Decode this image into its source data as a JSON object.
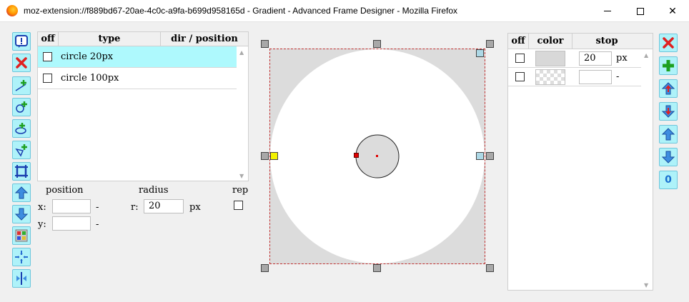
{
  "window": {
    "title": "moz-extension://f889bd67-20ae-4c0c-a9fa-b699d958165d - Gradient - Advanced Frame Designer - Mozilla Firefox",
    "minimize": "",
    "maximize": "",
    "close": "✕"
  },
  "left_toolbar": [
    {
      "name": "info-button",
      "icon": "info-icon"
    },
    {
      "name": "delete-layer-button",
      "icon": "red-x-icon"
    },
    {
      "name": "add-linear-button",
      "icon": "add-linear-icon"
    },
    {
      "name": "add-radial-button",
      "icon": "add-radial-icon"
    },
    {
      "name": "add-ellipse-button",
      "icon": "add-ellipse-icon"
    },
    {
      "name": "add-conic-button",
      "icon": "add-conic-icon"
    },
    {
      "name": "frame-button",
      "icon": "frame-icon"
    },
    {
      "name": "move-up-button",
      "icon": "arrow-up-icon"
    },
    {
      "name": "move-down-button",
      "icon": "arrow-down-icon"
    },
    {
      "name": "palette-button",
      "icon": "palette-icon"
    },
    {
      "name": "center-button",
      "icon": "center-icon"
    },
    {
      "name": "mirror-button",
      "icon": "mirror-icon"
    }
  ],
  "layers": {
    "headers": {
      "off": "off",
      "type": "type",
      "dir": "dir / position"
    },
    "rows": [
      {
        "type": "circle 20px",
        "selected": true
      },
      {
        "type": "circle 100px",
        "selected": false
      }
    ]
  },
  "layer_props": {
    "position_label": "position",
    "radius_label": "radius",
    "rep_label": "rep",
    "x_label": "x:",
    "x_value": "",
    "x_suffix": "-",
    "y_label": "y:",
    "y_value": "",
    "y_suffix": "-",
    "r_label": "r:",
    "r_value": "20",
    "r_unit": "px"
  },
  "stops": {
    "headers": {
      "off": "off",
      "color": "color",
      "stop": "stop"
    },
    "rows": [
      {
        "color": "#d8d8d8",
        "stop": "20",
        "unit": "px"
      },
      {
        "color": "transparent",
        "stop": "",
        "unit": "-"
      }
    ]
  },
  "right_toolbar": [
    {
      "name": "delete-stop-button",
      "icon": "red-x-icon"
    },
    {
      "name": "add-stop-button",
      "icon": "green-plus-icon"
    },
    {
      "name": "stop-up-red-button",
      "icon": "red-arrow-up-icon"
    },
    {
      "name": "stop-down-red-button",
      "icon": "red-arrow-down-icon"
    },
    {
      "name": "stop-up-button",
      "icon": "arrow-up-icon"
    },
    {
      "name": "stop-down-button",
      "icon": "arrow-down-icon"
    },
    {
      "name": "zero-button",
      "icon": "zero-icon",
      "label": "0"
    }
  ],
  "colors": {
    "button_bg": "#aef2f9",
    "selected_row": "#aef9fd",
    "canvas_bg": "#dcdcdc"
  }
}
